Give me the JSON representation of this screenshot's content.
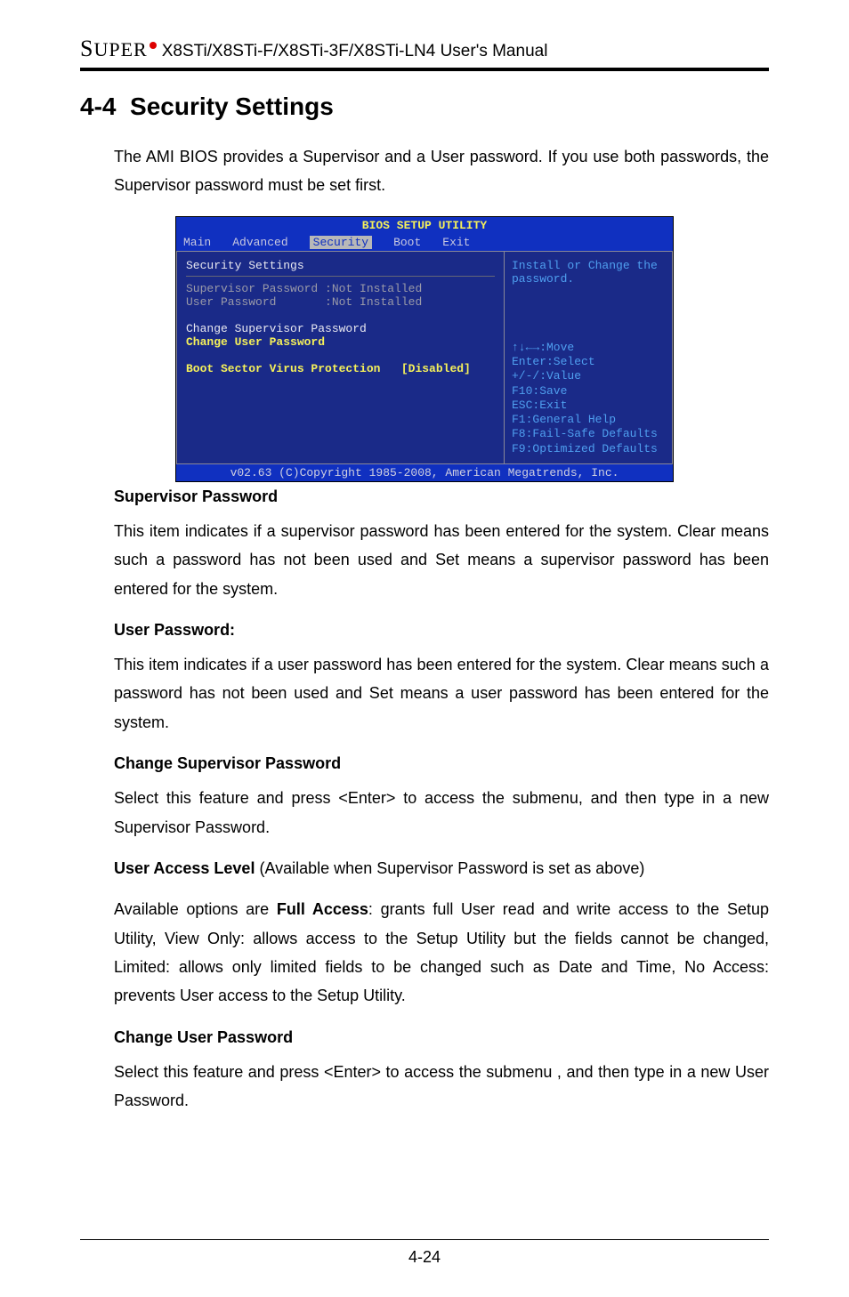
{
  "header": {
    "brand_prefix": "S",
    "brand_rest": "UPER",
    "manual": "X8STi/X8STi-F/X8STi-3F/X8STi-LN4 User's Manual"
  },
  "section": {
    "number": "4-4",
    "title": "Security Settings"
  },
  "intro": "The AMI BIOS provides a Supervisor and a User password. If you use both passwords, the Supervisor password must be set first.",
  "bios": {
    "title": "BIOS SETUP UTILITY",
    "menu": [
      "Main",
      "Advanced",
      "Security",
      "Boot",
      "Exit"
    ],
    "menu_selected": 2,
    "left": {
      "heading": "Security Settings",
      "sup_label": "Supervisor Password",
      "sup_value": ":Not Installed",
      "user_label": "User Password",
      "user_value": ":Not Installed",
      "change_sup": "Change Supervisor Password",
      "change_user": "Change User Password",
      "bsvp_label": "Boot Sector Virus Protection",
      "bsvp_value": "[Disabled]"
    },
    "right": {
      "help": "Install or Change the password.",
      "keys": [
        "↑↓←→:Move",
        "Enter:Select",
        "+/-/:Value",
        "F10:Save",
        "ESC:Exit",
        "F1:General Help",
        "F8:Fail-Safe Defaults",
        "F9:Optimized Defaults"
      ]
    },
    "footer": "v02.63 (C)Copyright 1985-2008, American Megatrends, Inc."
  },
  "body": {
    "h_sup": "Supervisor Password",
    "p_sup": "This item indicates if a supervisor password has been entered for the system. Clear means such a password has not been used and Set means a supervisor password has been entered for the system.",
    "h_user": "User Password:",
    "p_user": "This item indicates if a user password has been entered for the system. Clear means such a password has not been used and Set means a user password has been entered for the system.",
    "h_chsup": "Change Supervisor Password",
    "p_chsup": "Select this feature and press <Enter> to access the submenu, and then type in a new Supervisor Password.",
    "ual_label": "User Access Level",
    "ual_note": " (Available when Supervisor Password is set as above)",
    "p_ual1": "Available options are ",
    "p_ual_bold": "Full Access",
    "p_ual2": ": grants full User read and write access to the Setup Utility, View Only: allows access to the Setup Utility but the fields cannot be changed, Limited: allows only limited fields to be changed such as Date and Time, No Access: prevents User access to the Setup Utility.",
    "h_chuser": "Change User Password",
    "p_chuser": "Select this feature and press <Enter> to access the submenu , and then type in a new User Password."
  },
  "page_number": "4-24",
  "chart_data": {
    "type": "table",
    "title": "BIOS Security Settings screen",
    "rows": [
      {
        "field": "Supervisor Password",
        "value": "Not Installed"
      },
      {
        "field": "User Password",
        "value": "Not Installed"
      },
      {
        "field": "Boot Sector Virus Protection",
        "value": "Disabled"
      }
    ]
  }
}
